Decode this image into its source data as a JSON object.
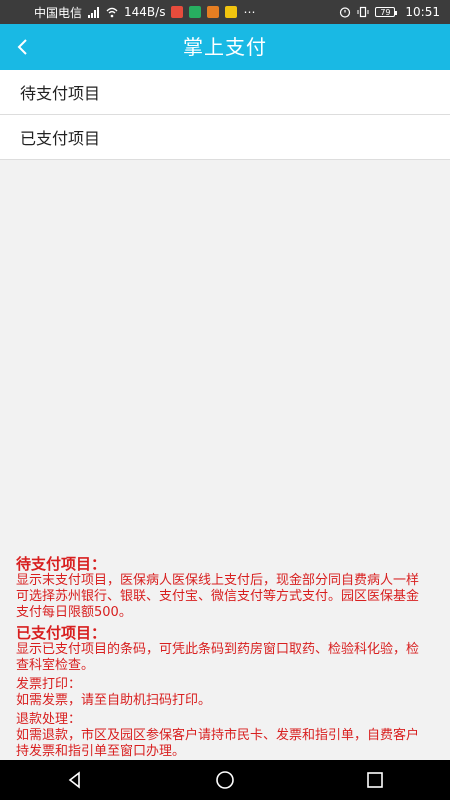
{
  "status_bar": {
    "carrier": "中国电信",
    "network_speed": "144B/s",
    "battery": "79",
    "time": "10:51",
    "icons": [
      "signal-icon",
      "wifi-icon",
      "app-notification-icons",
      "more-icon",
      "alarm-icon",
      "vibrate-icon",
      "battery-icon"
    ]
  },
  "header": {
    "title": "掌上支付",
    "background": "#19b9e4"
  },
  "menu": {
    "items": [
      {
        "label": "待支付项目"
      },
      {
        "label": "已支付项目"
      }
    ]
  },
  "notes": {
    "color": "#d81f1f",
    "pending_title": "待支付项目：",
    "pending_body": "显示末支付项目，医保病人医保线上支付后，现金部分同自费病人一样可选择苏州银行、银联、支付宝、微信支付等方式支付。园区医保基金支付每日限额500。",
    "paid_title": "已支付项目：",
    "paid_body": "显示已支付项目的条码，可凭此条码到药房窗口取药、检验科化验，检查科室检查。",
    "invoice_title": "发票打印：",
    "invoice_body": "如需发票，请至自助机扫码打印。",
    "refund_title": "退款处理：",
    "refund_body": "如需退款，市区及园区参保客户请持市民卡、发票和指引单，自费客户持发票和指引单至窗口办理。"
  },
  "nav_bar": {
    "buttons": [
      "back-triangle-icon",
      "home-circle-icon",
      "recents-square-icon"
    ]
  }
}
